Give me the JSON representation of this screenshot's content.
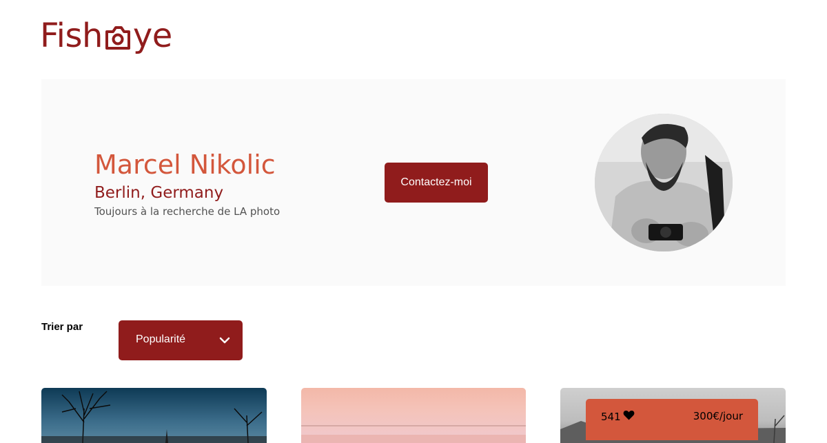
{
  "logo": {
    "text_before": "Fish",
    "text_after": "ye",
    "icon": "camera-icon",
    "color": "#901c1c"
  },
  "photographer": {
    "name": "Marcel Nikolic",
    "location": "Berlin, Germany",
    "tagline": "Toujours à la recherche de LA photo",
    "portrait_icon": "portrait-photo"
  },
  "contact_button": {
    "label": "Contactez-moi"
  },
  "sort": {
    "label": "Trier par",
    "selected": "Popularité",
    "icon": "chevron-down-icon"
  },
  "gallery": [
    {
      "name": "media-card-1"
    },
    {
      "name": "media-card-2"
    },
    {
      "name": "media-card-3"
    }
  ],
  "stats": {
    "likes": "541",
    "like_icon": "heart-icon",
    "price": "300€/jour"
  },
  "colors": {
    "primary": "#901c1c",
    "secondary": "#d3573c",
    "hero_bg": "#fafafa"
  }
}
